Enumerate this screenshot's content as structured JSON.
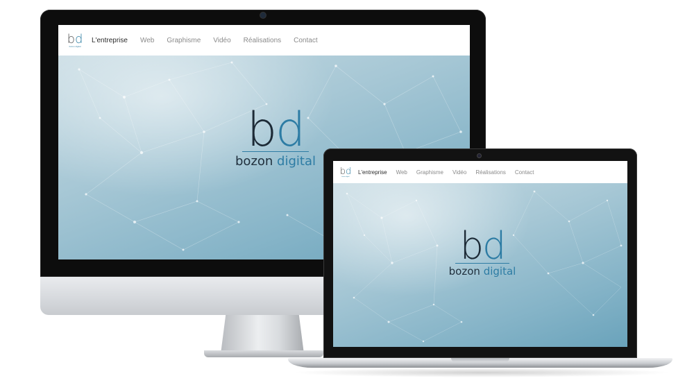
{
  "site": {
    "logo": {
      "letter_b": "b",
      "letter_d": "d",
      "sub": "bozon digital"
    },
    "nav": [
      {
        "label": "L'entreprise",
        "active": true
      },
      {
        "label": "Web",
        "active": false
      },
      {
        "label": "Graphisme",
        "active": false
      },
      {
        "label": "Vidéo",
        "active": false
      },
      {
        "label": "Réalisations",
        "active": false
      },
      {
        "label": "Contact",
        "active": false
      }
    ],
    "hero": {
      "brand_b": "b",
      "brand_d": "d",
      "brand_word1": "bozon",
      "brand_word2": "digital"
    }
  },
  "colors": {
    "accent": "#2d7ca4",
    "dark_text": "#1c2a36",
    "nav_muted": "#8a8a8a",
    "hero_light": "#c7dbe3",
    "hero_dark": "#6aa3bb"
  },
  "devices": [
    "imac",
    "macbook"
  ]
}
